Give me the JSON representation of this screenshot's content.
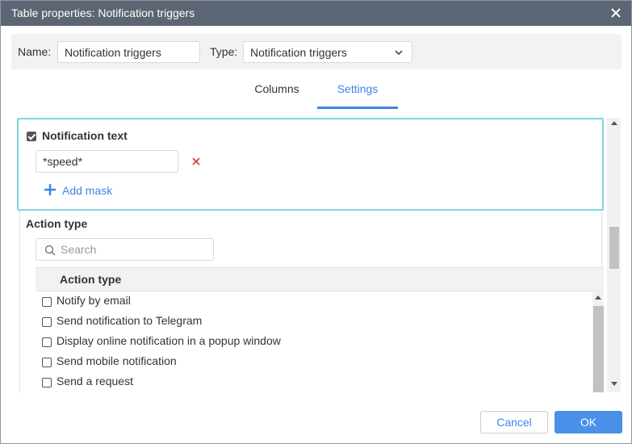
{
  "dialog": {
    "title": "Table properties: Notification triggers",
    "close_icon": "close-icon"
  },
  "header": {
    "name_label": "Name:",
    "name_value": "Notification triggers",
    "type_label": "Type:",
    "type_value": "Notification triggers"
  },
  "tabs": [
    {
      "label": "Columns",
      "active": false
    },
    {
      "label": "Settings",
      "active": true
    }
  ],
  "notification_text": {
    "checked": true,
    "heading": "Notification text",
    "mask_value": "*speed*",
    "add_mask_label": "Add mask"
  },
  "action_type": {
    "heading": "Action type",
    "search_placeholder": "Search",
    "column_header": "Action type",
    "items": [
      {
        "label": "Notify by email",
        "checked": false
      },
      {
        "label": "Send notification to Telegram",
        "checked": false
      },
      {
        "label": "Display online notification in a popup window",
        "checked": false
      },
      {
        "label": "Send mobile notification",
        "checked": false
      },
      {
        "label": "Send a request",
        "checked": false
      }
    ]
  },
  "footer": {
    "cancel_label": "Cancel",
    "ok_label": "OK"
  },
  "colors": {
    "accent": "#3f86e6",
    "titlebar": "#5b6574",
    "focus_border": "#7fd8e0",
    "remove": "#e53935"
  }
}
